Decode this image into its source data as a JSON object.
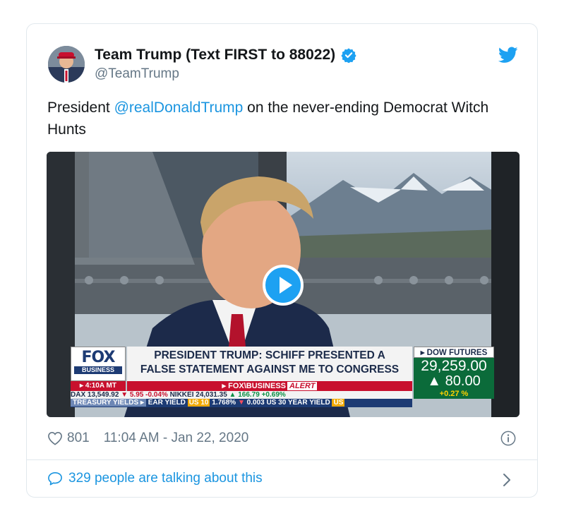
{
  "tweet": {
    "author": {
      "display_name": "Team Trump (Text FIRST to 88022)",
      "handle": "@TeamTrump",
      "verified": true
    },
    "text": {
      "prefix": "President ",
      "mention": "@realDonaldTrump",
      "suffix": " on the never-ending Democrat Witch Hunts"
    },
    "media": {
      "type": "video",
      "play_icon": "play-icon",
      "chyron": {
        "network_logo": "FOX",
        "network_sub": "BUSINESS",
        "time": "▸ 4:10A MT",
        "headline_line1": "PRESIDENT TRUMP: SCHIFF PRESENTED A",
        "headline_line2": "FALSE STATEMENT AGAINST ME TO CONGRESS",
        "alert_prefix": "▸ FOX\\BUSINESS",
        "alert_word": "ALERT",
        "futures_title": "▸ DOW FUTURES",
        "futures_value": "29,259.00",
        "futures_change": "▲ 80.00",
        "futures_pct": "+0.27 %",
        "ticker1": {
          "dax_label": "DAX",
          "dax_value": "13,549.92",
          "dax_change": "▼ 5.95",
          "dax_pct": "-0.04%",
          "nikkei_label": "NIKKEI",
          "nikkei_value": "24,031.35",
          "nikkei_change": "▲ 166.79",
          "nikkei_pct": "+0.69%"
        },
        "ticker2": {
          "tag": "TREASURY YIELDS ▸",
          "text1": " EAR YIELD ",
          "hl1": "US 10",
          "text2": " 1.768% ",
          "change": "▼",
          "text3": " 0.003  US 30 YEAR YIELD ",
          "hl2": "US"
        }
      }
    },
    "likes": "801",
    "timestamp": "11:04 AM - Jan 22, 2020",
    "conversation": "329 people are talking about this"
  },
  "colors": {
    "twitter_blue": "#1da1f2",
    "link_blue": "#1b95e0",
    "secondary_text": "#657786",
    "fox_red": "#c8102e",
    "fox_navy": "#1d3b74",
    "futures_green": "#0b6b3a"
  },
  "icons": [
    "avatar",
    "verified-badge-icon",
    "twitter-bird-icon",
    "play-icon",
    "heart-icon",
    "info-icon",
    "speech-bubble-icon",
    "chevron-right-icon"
  ]
}
